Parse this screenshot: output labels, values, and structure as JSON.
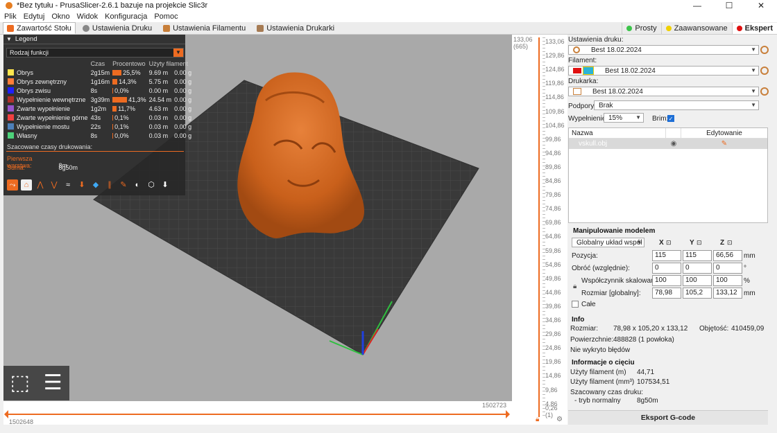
{
  "window": {
    "title": "*Bez tytułu - PrusaSlicer-2.6.1 bazuje na projekcie Slic3r",
    "controls": [
      "—",
      "☐",
      "✕"
    ]
  },
  "menu": [
    "Plik",
    "Edytuj",
    "Okno",
    "Widok",
    "Konfiguracja",
    "Pomoc"
  ],
  "tabs": [
    {
      "label": "Zawartość Stołu",
      "active": true
    },
    {
      "label": "Ustawienia Druku",
      "active": false
    },
    {
      "label": "Ustawienia Filamentu",
      "active": false
    },
    {
      "label": "Ustawienia Drukarki",
      "active": false
    }
  ],
  "modes": [
    {
      "label": "Prosty",
      "color": "#3cc44a",
      "active": false
    },
    {
      "label": "Zaawansowane",
      "color": "#f0d000",
      "active": false
    },
    {
      "label": "Ekspert",
      "color": "#e01010",
      "active": true
    }
  ],
  "legend": {
    "title": "Legend",
    "view_type": "Rodzaj funkcji",
    "columns": [
      "Czas",
      "Procentowo",
      "Użyty filament"
    ],
    "rows": [
      {
        "color": "#ffe64d",
        "name": "Obrys",
        "time": "2g15m",
        "pct": "25,5%",
        "len": "9.69 m",
        "weight": "0.00 g",
        "frac": 0.255
      },
      {
        "color": "#ff7d38",
        "name": "Obrys zewnętrzny",
        "time": "1g16m",
        "pct": "14,3%",
        "len": "5.75 m",
        "weight": "0.00 g",
        "frac": 0.143
      },
      {
        "color": "#1f1fff",
        "name": "Obrys zwisu",
        "time": "8s",
        "pct": "0,0%",
        "len": "0.00 m",
        "weight": "0.00 g",
        "frac": 0.0
      },
      {
        "color": "#b03029",
        "name": "Wypełnienie wewnętrzne",
        "time": "3g39m",
        "pct": "41,3%",
        "len": "24.54 m",
        "weight": "0.00 g",
        "frac": 0.413
      },
      {
        "color": "#9654cc",
        "name": "Zwarte wypełnienie",
        "time": "1g2m",
        "pct": "11,7%",
        "len": "4.63 m",
        "weight": "0.00 g",
        "frac": 0.117
      },
      {
        "color": "#f04040",
        "name": "Zwarte wypełnienie górne",
        "time": "43s",
        "pct": "0,1%",
        "len": "0.03 m",
        "weight": "0.00 g",
        "frac": 0.001
      },
      {
        "color": "#4d80ba",
        "name": "Wypełnienie mostu",
        "time": "22s",
        "pct": "0,1%",
        "len": "0.03 m",
        "weight": "0.00 g",
        "frac": 0.001
      },
      {
        "color": "#4dd27a",
        "name": "Własny",
        "time": "8s",
        "pct": "0,0%",
        "len": "0.03 m",
        "weight": "0.00 g",
        "frac": 0.0
      }
    ],
    "times_title": "Szacowane czasy drukowania:",
    "first_layer_label": "Pierwsza warstwa:",
    "first_layer": "8m",
    "total_label": "Suma:",
    "total": "8g50m"
  },
  "hslider": {
    "right": "1502723",
    "left": "1502648"
  },
  "vslider": {
    "top_value": "133,06",
    "top_layer": "(665)",
    "ticks": [
      "133,06",
      "129,86",
      "124,86",
      "119,86",
      "114,86",
      "109,86",
      "104,86",
      "99,86",
      "94,86",
      "89,86",
      "84,86",
      "79,86",
      "74,86",
      "69,86",
      "64,86",
      "59,86",
      "54,86",
      "49,86",
      "44,86",
      "39,86",
      "34,86",
      "29,86",
      "24,86",
      "19,86",
      "14,86",
      "9,86",
      "4,86"
    ],
    "bottom_value": "0,26",
    "bottom_layer": "(1)"
  },
  "sidebar": {
    "print_settings_label": "Ustawienia druku:",
    "print_settings_value": "Best 18.02.2024",
    "filament_label": "Filament:",
    "filament_value": "Best 18.02.2024",
    "printer_label": "Drukarka:",
    "printer_value": "Best 18.02.2024",
    "supports_label": "Podpory:",
    "supports_value": "Brak",
    "infill_label": "Wypełnienie:",
    "infill_value": "15%",
    "brim_label": "Brim:",
    "objects": {
      "col_name": "Nazwa",
      "col_edit": "Edytowanie",
      "items": [
        {
          "name": "vskull.obj"
        }
      ]
    },
    "manip": {
      "title": "Manipulowanie modelem",
      "coord_system": "Globalny układ współ",
      "axes": [
        "X",
        "Y",
        "Z"
      ],
      "position_label": "Pozycja:",
      "position": [
        "115",
        "115",
        "66,56"
      ],
      "position_unit": "mm",
      "rotate_label": "Obróć (względnie):",
      "rotate": [
        "0",
        "0",
        "0"
      ],
      "rotate_unit": "°",
      "scale_label": "Współczynnik skalowania:",
      "scale": [
        "100",
        "100",
        "100"
      ],
      "scale_unit": "%",
      "size_label": "Rozmiar [globalny]:",
      "size": [
        "78,98",
        "105,2",
        "133,12"
      ],
      "size_unit": "mm",
      "uniform_label": "Całe"
    },
    "info": {
      "title": "Info",
      "size_label": "Rozmiar:",
      "size_value": "78,98 x 105,20 x 133,12",
      "volume_label": "Objętość:",
      "volume_value": "410459,09",
      "facets_label": "Powierzchnie:",
      "facets_value": "488828 (1 powłoka)",
      "errors": "Nie wykryto błędów"
    },
    "slice_info": {
      "title": "Informacje o cięciu",
      "used_m_label": "Użyty filament (m)",
      "used_m": "44,71",
      "used_mm3_label": "Użyty filament (mm³)",
      "used_mm3": "107534,51",
      "est_label": "Szacowany czas druku:",
      "mode_label": "- tryb normalny",
      "mode_value": "8g50m"
    },
    "export_label": "Eksport G-code"
  }
}
